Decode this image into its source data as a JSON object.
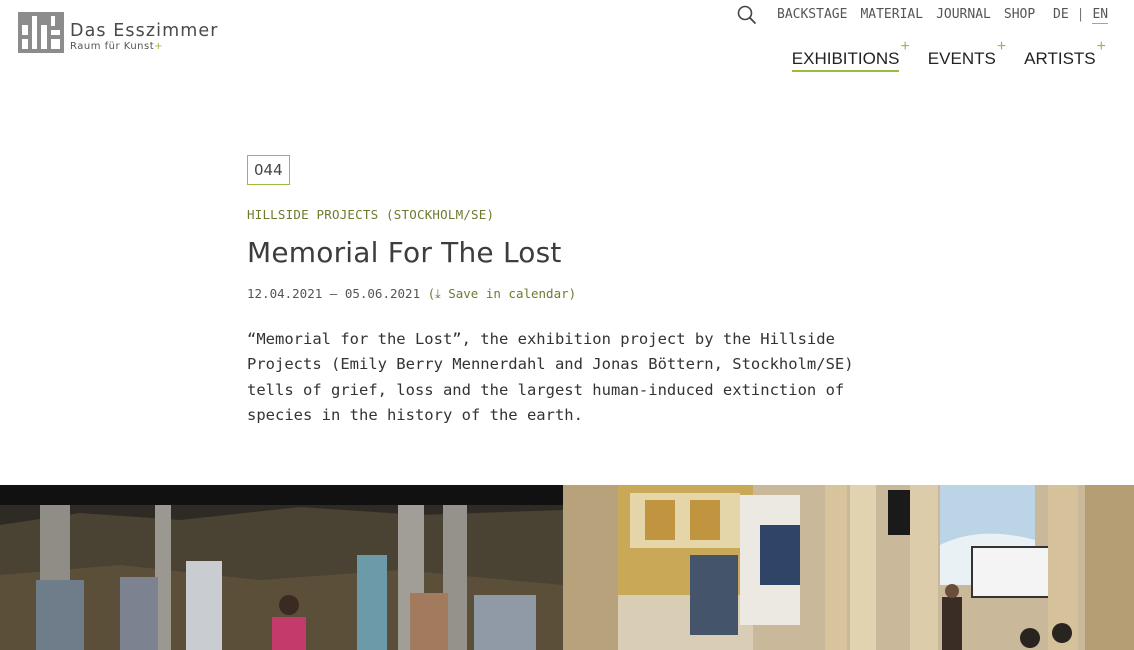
{
  "brand": {
    "title": "Das Esszimmer",
    "subtitle": "Raum für Kunst",
    "plus": "+"
  },
  "top_nav": {
    "items": [
      "BACKSTAGE",
      "MATERIAL",
      "JOURNAL",
      "SHOP"
    ]
  },
  "language": {
    "de": "DE",
    "separator": "|",
    "en": "EN",
    "active": "EN"
  },
  "main_nav": {
    "items": [
      {
        "label": "EXHIBITIONS",
        "active": true
      },
      {
        "label": "EVENTS",
        "active": false
      },
      {
        "label": "ARTISTS",
        "active": false
      }
    ],
    "plus": "+"
  },
  "exhibition": {
    "number": "044",
    "kicker": "HILLSIDE PROJECTS (STOCKHOLM/SE)",
    "title": "Memorial For The Lost",
    "date_range": "12.04.2021 – 05.06.2021",
    "calendar_open": "(",
    "calendar_link": "⤓ Save in calendar",
    "calendar_close": ")",
    "lead": "“Memorial for the Lost”, the exhibition project by the Hillside Projects (Emily Berry Mennerdahl and Jonas Böttern, Stockholm/SE) tells of grief, loss and the largest human-induced extinction of species in the history of the earth."
  },
  "colors": {
    "accent": "#9bbb3c",
    "kicker": "#6f7a30",
    "text": "#333333"
  },
  "icons": {
    "search": "search-icon",
    "logo": "logo-mark-icon"
  }
}
